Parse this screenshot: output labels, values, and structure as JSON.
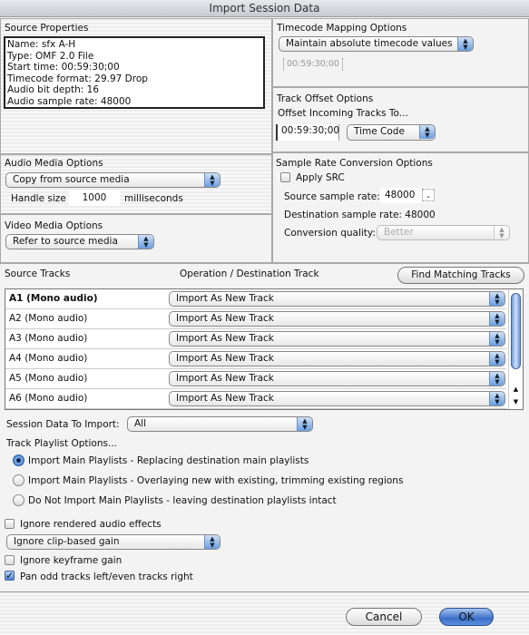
{
  "window": {
    "title": "Import Session Data"
  },
  "source_properties": {
    "heading": "Source Properties",
    "lines": [
      "Name: sfx A-H",
      "Type: OMF 2.0 File",
      "Start time: 00:59:30;00",
      "Timecode format: 29.97 Drop",
      "Audio bit depth: 16",
      "Audio sample rate: 48000"
    ]
  },
  "timecode_mapping": {
    "heading": "Timecode Mapping Options",
    "selected": "Maintain absolute timecode values",
    "timecode_value": "00:59:30;00"
  },
  "track_offset": {
    "heading": "Track Offset Options",
    "subheading": "Offset Incoming Tracks To...",
    "value": "00:59:30;00",
    "unit_selected": "Time Code"
  },
  "audio_media": {
    "heading": "Audio Media Options",
    "selected": "Copy from source media",
    "handle_label": "Handle size",
    "handle_value": "1000",
    "handle_unit": "milliseconds"
  },
  "video_media": {
    "heading": "Video Media Options",
    "selected": "Refer to source media"
  },
  "src": {
    "heading": "Sample Rate Conversion Options",
    "apply_label": "Apply SRC",
    "apply_checked": false,
    "source_rate_label": "Source sample rate:",
    "source_rate_value": "48000",
    "dest_rate_text": "Destination sample rate: 48000",
    "quality_label": "Conversion quality:",
    "quality_selected": "Better"
  },
  "tracks": {
    "col_source": "Source Tracks",
    "col_operation": "Operation / Destination Track",
    "find_button": "Find Matching Tracks",
    "rows": [
      {
        "source": "A1 (Mono audio)",
        "operation": "Import As New Track"
      },
      {
        "source": "A2 (Mono audio)",
        "operation": "Import As New Track"
      },
      {
        "source": "A3 (Mono audio)",
        "operation": "Import As New Track"
      },
      {
        "source": "A4 (Mono audio)",
        "operation": "Import As New Track"
      },
      {
        "source": "A5 (Mono audio)",
        "operation": "Import As New Track"
      },
      {
        "source": "A6 (Mono audio)",
        "operation": "Import As New Track"
      }
    ]
  },
  "session_data": {
    "label": "Session Data To Import:",
    "selected": "All"
  },
  "playlist": {
    "heading": "Track Playlist Options...",
    "options": [
      {
        "label": "Import Main Playlists - Replacing destination main playlists",
        "selected": true
      },
      {
        "label": "Import Main Playlists - Overlaying new with existing, trimming existing regions",
        "selected": false
      },
      {
        "label": "Do Not Import Main Playlists - leaving destination playlists intact",
        "selected": false
      }
    ]
  },
  "options": {
    "ignore_rendered": {
      "label": "Ignore rendered audio effects",
      "checked": false
    },
    "clip_gain_selected": "Ignore clip-based gain",
    "ignore_keyframe": {
      "label": "Ignore keyframe gain",
      "checked": false
    },
    "pan_odd_even": {
      "label": "Pan odd tracks left/even tracks right",
      "checked": true
    }
  },
  "buttons": {
    "cancel": "Cancel",
    "ok": "OK"
  }
}
